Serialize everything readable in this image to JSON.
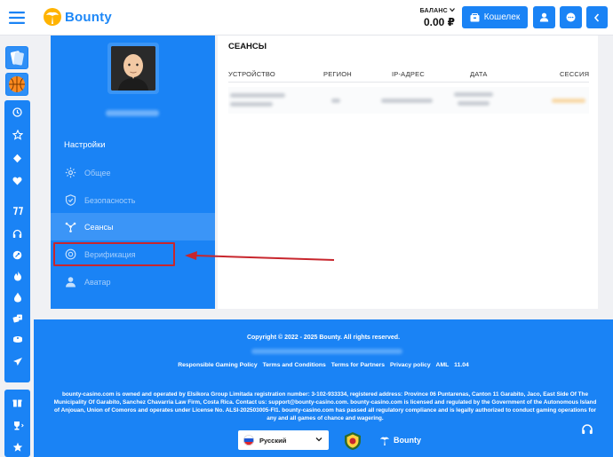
{
  "header": {
    "brand": "Bounty",
    "balance_label": "БАЛАНС",
    "balance_value": "0.00 ₽",
    "wallet_label": "Кошелек"
  },
  "profile": {
    "settings_title": "Настройки",
    "menu": [
      {
        "label": "Общее",
        "icon": "gear-icon"
      },
      {
        "label": "Безопасность",
        "icon": "shield-icon"
      },
      {
        "label": "Сеансы",
        "icon": "sessions-icon",
        "active": true
      },
      {
        "label": "Верификация",
        "icon": "verification-icon"
      },
      {
        "label": "Аватар",
        "icon": "avatar-icon"
      }
    ]
  },
  "sessions": {
    "title": "СЕАНСЫ",
    "columns": [
      "УСТРОЙСТВО",
      "РЕГИОН",
      "IP-АДРЕС",
      "ДАТА",
      "СЕССИЯ"
    ]
  },
  "footer": {
    "copyright": "Copyright © 2022 - 2025 Bounty. All rights reserved.",
    "links": [
      "Responsible Gaming Policy",
      "Terms and Conditions",
      "Terms for Partners",
      "Privacy policy",
      "AML",
      "11.04"
    ],
    "legal": "bounty-casino.com is owned and operated by Elsikora Group Limitada registration number: 3-102-933334, registered address: Province 06 Puntarenas, Canton 11 Garabito, Jaco, East Side Of The Municipality Of Garabito, Sanchez Chavarria Law Firm, Costa Rica. Contact us: support@bounty-casino.com. bounty-casino.com is licensed and regulated by the Government of the Autonomous Island of Anjouan, Union of Comoros and operates under License No. ALSI-202503005-FI1. bounty-casino.com has passed all regulatory compliance and is legally authorized to conduct gaming operations for any and all games of chance and wagering.",
    "language": "Русский",
    "brand": "Bounty"
  },
  "colors": {
    "primary": "#1a83f5",
    "annotation": "#c8262d"
  }
}
